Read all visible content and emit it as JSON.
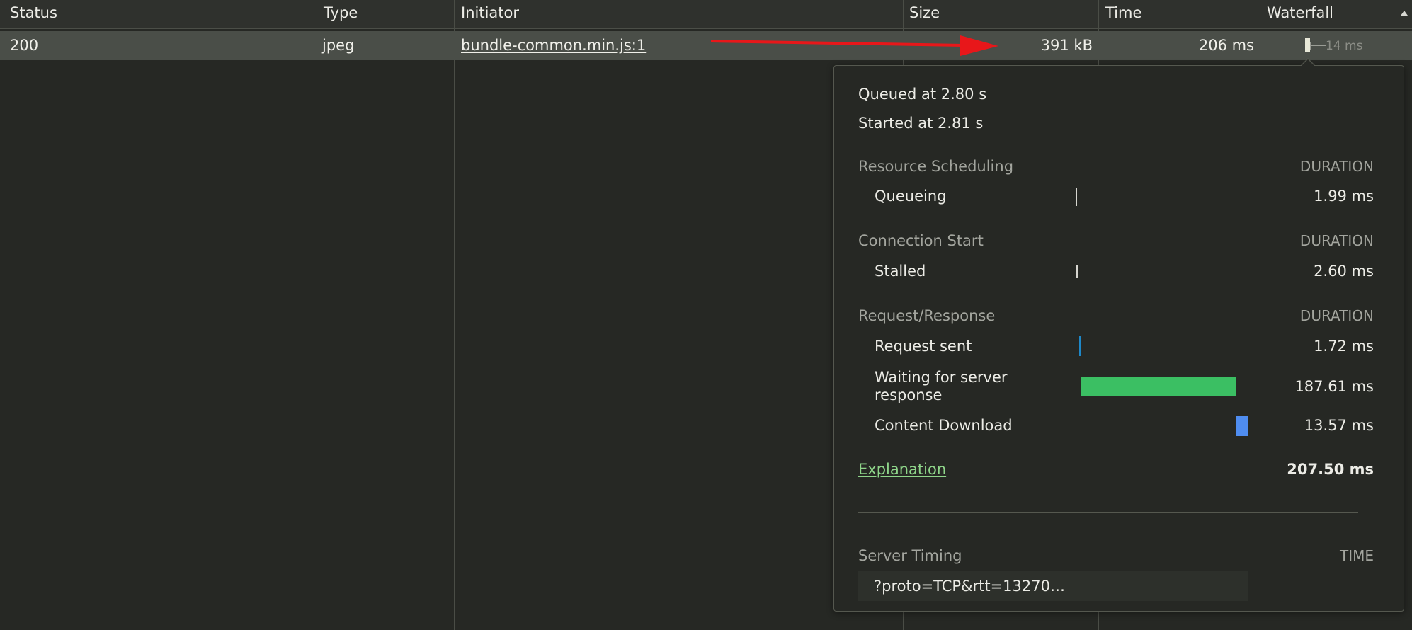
{
  "table": {
    "columns": [
      {
        "key": "status",
        "label": "Status"
      },
      {
        "key": "type",
        "label": "Type"
      },
      {
        "key": "initiator",
        "label": "Initiator"
      },
      {
        "key": "size",
        "label": "Size"
      },
      {
        "key": "time",
        "label": "Time"
      },
      {
        "key": "waterfall",
        "label": "Waterfall"
      }
    ],
    "sort_indicator": "ascending",
    "rows": [
      {
        "status": "200",
        "type": "jpeg",
        "initiator": "bundle-common.min.js:1",
        "size": "391 kB",
        "time": "206 ms",
        "waterfall_label": "14 ms"
      }
    ]
  },
  "annotation": {
    "arrow_color": "#e8171a"
  },
  "timing": {
    "queued_at": "Queued at 2.80 s",
    "started_at": "Started at 2.81 s",
    "sections": [
      {
        "title": "Resource Scheduling",
        "column": "DURATION",
        "phases": [
          {
            "label": "Queueing",
            "value": "1.99 ms",
            "bar_color": "#d6d6d0"
          }
        ]
      },
      {
        "title": "Connection Start",
        "column": "DURATION",
        "phases": [
          {
            "label": "Stalled",
            "value": "2.60 ms",
            "bar_color": "#d6d6d0"
          }
        ]
      },
      {
        "title": "Request/Response",
        "column": "DURATION",
        "phases": [
          {
            "label": "Request sent",
            "value": "1.72 ms",
            "bar_color": "#1e88c8"
          },
          {
            "label": "Waiting for server response",
            "value": "187.61 ms",
            "bar_color": "#3bbf63"
          },
          {
            "label": "Content Download",
            "value": "13.57 ms",
            "bar_color": "#4f8df0"
          }
        ]
      }
    ],
    "explanation_link": "Explanation",
    "total": "207.50 ms",
    "server_timing": {
      "title": "Server Timing",
      "column": "TIME",
      "entry": "?proto=TCP&rtt=13270…"
    }
  }
}
